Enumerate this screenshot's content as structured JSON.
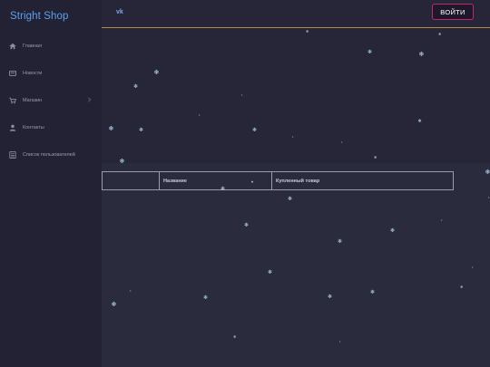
{
  "sidebar": {
    "brand": "Stright Shop",
    "items": [
      {
        "label": "Главная",
        "icon": "home-icon"
      },
      {
        "label": "Новости",
        "icon": "news-icon"
      },
      {
        "label": "Магазин",
        "icon": "cart-icon"
      },
      {
        "label": "Контакты",
        "icon": "user-icon"
      },
      {
        "label": "Список пользователей",
        "icon": "list-icon"
      }
    ]
  },
  "header": {
    "social": "vk",
    "login_label": "ВОЙТИ"
  },
  "table": {
    "columns": [
      "",
      "Название",
      "Купленный товар"
    ],
    "sort_glyph": "▾"
  },
  "decor": {
    "snowflake": "❄",
    "dot": "•"
  },
  "colors": {
    "background": "#262638",
    "sidebar": "#222234",
    "brand": "#5aa0ee",
    "login_border": "#c8246c",
    "header_line": "#b08a4a",
    "snow": "#bde4ff"
  }
}
